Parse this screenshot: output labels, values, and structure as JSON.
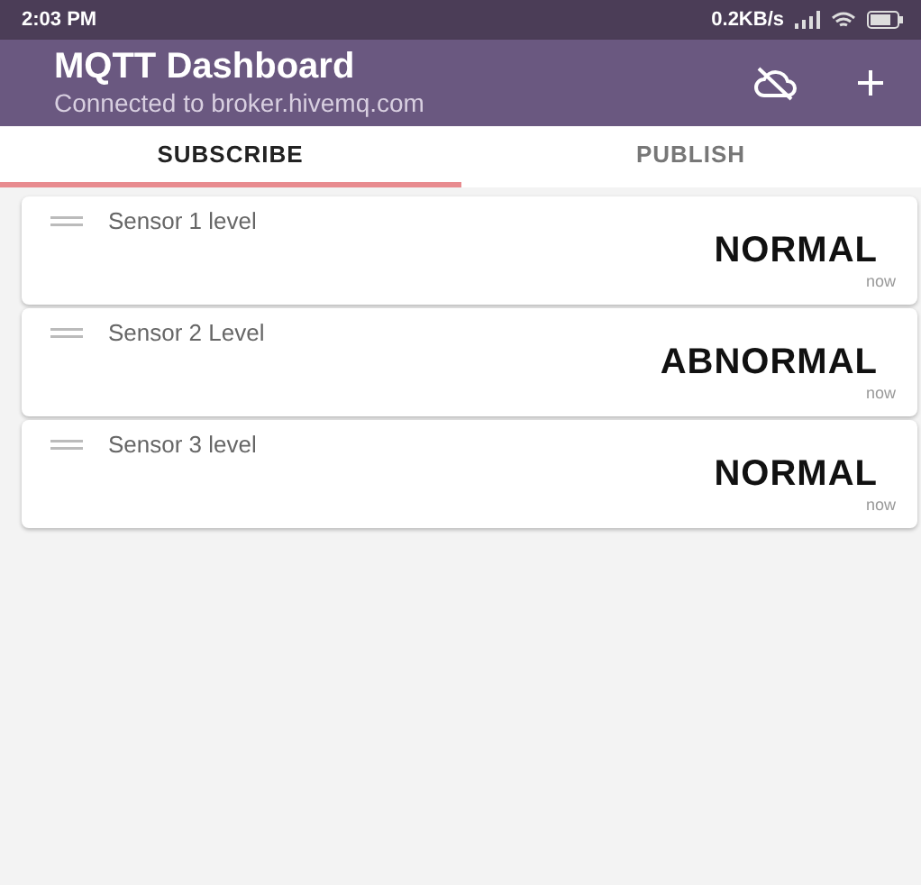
{
  "status_bar": {
    "time": "2:03 PM",
    "speed": "0.2KB/s"
  },
  "app_bar": {
    "title": "MQTT Dashboard",
    "subtitle": "Connected to broker.hivemq.com"
  },
  "tabs": [
    {
      "label": "SUBSCRIBE",
      "selected": true
    },
    {
      "label": "PUBLISH",
      "selected": false
    }
  ],
  "tiles": [
    {
      "name": "Sensor 1 level",
      "value": "NORMAL",
      "time": "now"
    },
    {
      "name": "Sensor 2 Level",
      "value": "ABNORMAL",
      "time": "now"
    },
    {
      "name": "Sensor 3 level",
      "value": "NORMAL",
      "time": "now"
    }
  ]
}
